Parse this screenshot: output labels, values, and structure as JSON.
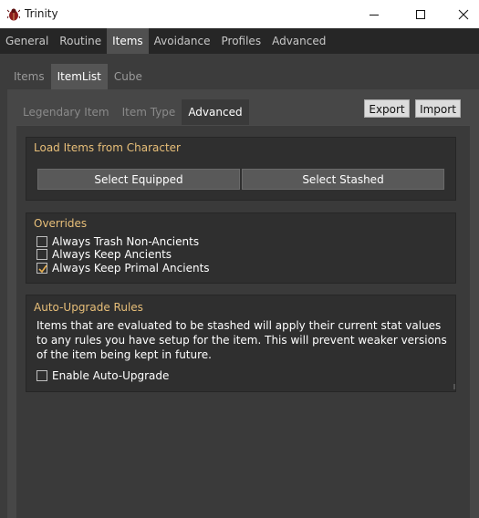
{
  "window": {
    "title": "Trinity",
    "app_icon": "bug-icon"
  },
  "main_tabs": [
    {
      "label": "General",
      "active": false
    },
    {
      "label": "Routine",
      "active": false
    },
    {
      "label": "Items",
      "active": true
    },
    {
      "label": "Avoidance",
      "active": false
    },
    {
      "label": "Profiles",
      "active": false
    },
    {
      "label": "Advanced",
      "active": false
    }
  ],
  "sub_tabs": [
    {
      "label": "Items",
      "active": false
    },
    {
      "label": "ItemList",
      "active": true
    },
    {
      "label": "Cube",
      "active": false
    }
  ],
  "third_tabs": [
    {
      "label": "Legendary Item",
      "active": false
    },
    {
      "label": "Item Type",
      "active": false
    },
    {
      "label": "Advanced",
      "active": true
    }
  ],
  "toolbar": {
    "export_label": "Export",
    "import_label": "Import"
  },
  "load_group": {
    "title": "Load Items from Character",
    "select_equipped_label": "Select Equipped",
    "select_stashed_label": "Select Stashed"
  },
  "overrides": {
    "title": "Overrides",
    "options": [
      {
        "label": "Always Trash Non-Ancients",
        "checked": false
      },
      {
        "label": "Always Keep Ancients",
        "checked": false
      },
      {
        "label": "Always Keep Primal Ancients",
        "checked": true
      }
    ]
  },
  "auto_upgrade": {
    "title": "Auto-Upgrade Rules",
    "description": "Items that are evaluated to be stashed will apply their current stat values to any rules you have setup for the item. This will prevent weaker versions of the item being kept in future.",
    "enable_label": "Enable Auto-Upgrade",
    "enable_checked": false
  },
  "colors": {
    "accent_title": "#e8bf79",
    "check_mark": "#e8b050"
  }
}
